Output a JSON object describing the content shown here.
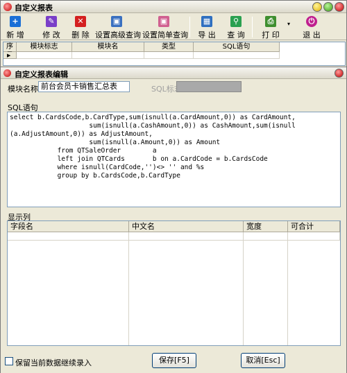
{
  "main_window": {
    "title": "自定义报表"
  },
  "toolbar": {
    "items": [
      {
        "label": "新 增",
        "icon": "plus-icon",
        "color": "#1a6fd6"
      },
      {
        "label": "修 改",
        "icon": "edit-icon",
        "color": "#7a3fc8"
      },
      {
        "label": "删 除",
        "icon": "delete-icon",
        "color": "#d42020"
      },
      {
        "label": "设置高级查询",
        "icon": "advanced-query-icon",
        "color": "#3a70c0"
      },
      {
        "label": "设置简单查询",
        "icon": "simple-query-icon",
        "color": "#d06090"
      },
      {
        "label": "导 出",
        "icon": "export-icon",
        "color": "#2f6fc0"
      },
      {
        "label": "查 询",
        "icon": "search-icon",
        "color": "#2aa050"
      },
      {
        "label": "打 印",
        "icon": "print-icon",
        "color": "#3f8f30"
      },
      {
        "label": "退 出",
        "icon": "power-icon",
        "color": "#c0208f"
      }
    ]
  },
  "top_grid": {
    "columns": [
      "序号",
      "模块标志",
      "模块名",
      "类型",
      "SQL语句"
    ]
  },
  "editor": {
    "title": "自定义报表编辑",
    "module_name_label": "模块名称",
    "module_name_value": "前台会员卡销售汇总表",
    "sql_flag_label": "SQL标志",
    "sql_flag_value": "",
    "sql_label": "SQL语句",
    "sql_text": "select b.CardsCode,b.CardType,sum(isnull(a.CardAmount,0)) as CardAmount,\n                    sum(isnull(a.CashAmount,0)) as CashAmount,sum(isnull\n(a.AdjustAmount,0)) as AdjustAmount,\n                    sum(isnull(a.Amount,0)) as Amount\n            from QTSaleOrder        a\n            left join QTCards       b on a.CardCode = b.CardsCode\n            where isnull(CardCode,'')<> '' and %s\n            group by b.CardsCode,b.CardType",
    "display_columns_label": "显示列",
    "columns_grid": {
      "headers": [
        "字段名",
        "中文名",
        "宽度",
        "可合计"
      ]
    },
    "keep_data_checkbox": {
      "label": "保留当前数据继续录入",
      "checked": false
    },
    "save_button": "保存[F5]",
    "cancel_button": "取消[Esc]"
  }
}
